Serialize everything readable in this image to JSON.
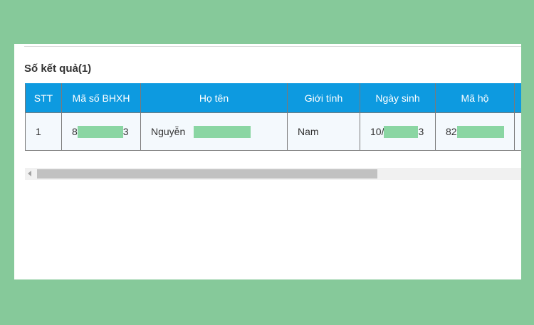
{
  "result_count_label": "Số kết quả(1)",
  "table": {
    "headers": [
      "STT",
      "Mã số BHXH",
      "Họ tên",
      "Giới tính",
      "Ngày sinh",
      "Mã hộ"
    ],
    "row": {
      "stt": "1",
      "bhxh_prefix": "8",
      "bhxh_suffix": "3",
      "name_prefix": "Nguyễn",
      "gender": "Nam",
      "dob_prefix": "10/",
      "dob_suffix": "3",
      "household_prefix": "82"
    }
  },
  "colors": {
    "background": "#86c99a",
    "header": "#0d9ae0",
    "redaction": "#8ad6a3"
  }
}
